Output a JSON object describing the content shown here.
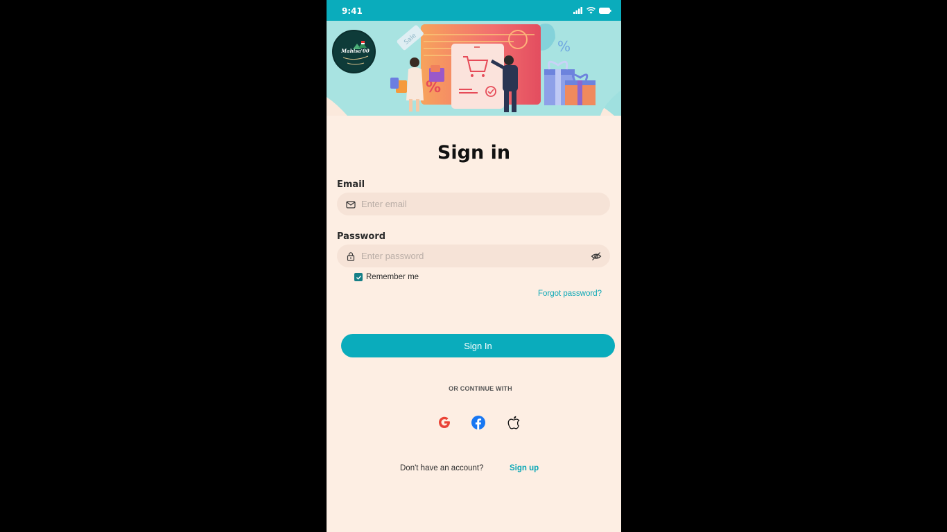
{
  "status_bar": {
    "time": "9:41"
  },
  "banner": {
    "logo_text": "Mahisa'00",
    "sale_tag": "Sale"
  },
  "title": "Sign in",
  "email": {
    "label": "Email",
    "placeholder": "Enter email",
    "value": ""
  },
  "password": {
    "label": "Password",
    "placeholder": "Enter password",
    "value": ""
  },
  "remember": {
    "label": "Remember me",
    "checked": true
  },
  "forgot_password": "Forgot password?",
  "sign_in_button": "Sign In",
  "or_continue": "OR CONTINUE WITH",
  "social": [
    {
      "name": "google-icon"
    },
    {
      "name": "facebook-icon"
    },
    {
      "name": "apple-icon"
    }
  ],
  "signup": {
    "prompt": "Don't have an account?",
    "link": "Sign up"
  },
  "colors": {
    "accent": "#0aacbc",
    "background": "#fdeee3",
    "field": "#f6e3d7",
    "checkbox": "#157f87"
  }
}
